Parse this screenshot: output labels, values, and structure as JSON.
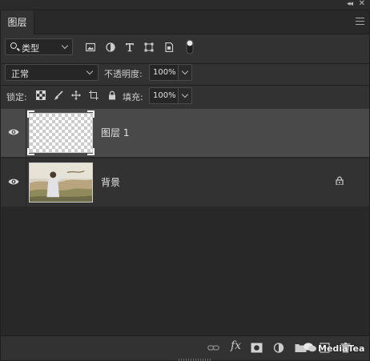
{
  "topbar": {
    "collapse_glyph": "◂◂",
    "close_glyph": "✕"
  },
  "panel": {
    "tab_label": "图层"
  },
  "filter": {
    "kind_label": "类型",
    "icons": [
      "image-filter-icon",
      "adjustment-filter-icon",
      "type-filter-icon",
      "shape-filter-icon",
      "smart-object-filter-icon",
      "filter-toggle-icon"
    ]
  },
  "blend": {
    "mode": "正常",
    "opacity_label": "不透明度:",
    "opacity_value": "100%"
  },
  "locks": {
    "label": "锁定:",
    "icons": [
      "lock-transparency-icon",
      "lock-pixels-icon",
      "lock-position-icon",
      "lock-artboard-icon",
      "lock-all-icon"
    ],
    "fill_label": "填充:",
    "fill_value": "100%"
  },
  "layers": [
    {
      "name": "图层 1",
      "visible": true,
      "selected": true,
      "type": "transparent"
    },
    {
      "name": "背景",
      "visible": true,
      "selected": false,
      "type": "photo",
      "locked": true
    }
  ],
  "footer": {
    "icons": [
      "link-layers-icon",
      "fx-icon",
      "add-mask-icon",
      "adjustment-layer-icon",
      "group-folder-icon",
      "new-layer-icon",
      "delete-icon"
    ],
    "fx_label": "fx",
    "watermark": "MediaTea"
  }
}
